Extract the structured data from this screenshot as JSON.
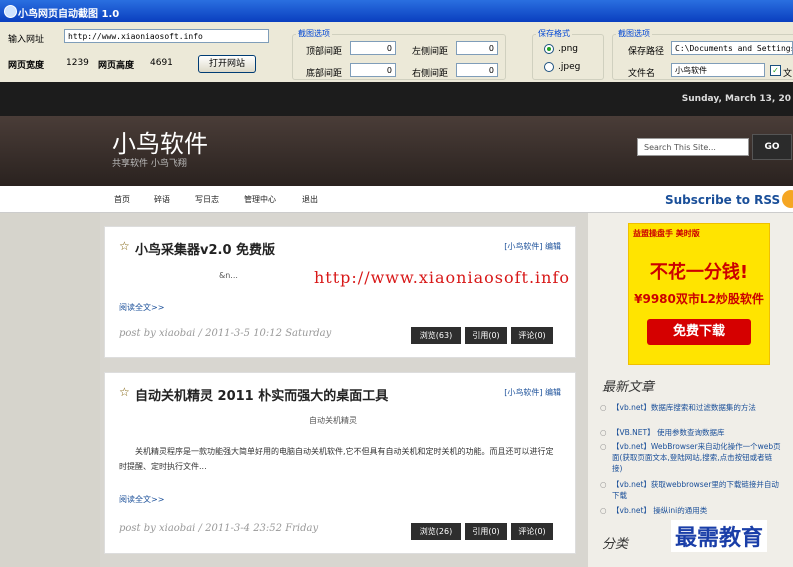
{
  "window": {
    "title": "小鸟网页自动截图 1.0"
  },
  "toolbar": {
    "url_label": "输入网址",
    "url_value": "http://www.xiaoniaosoft.info",
    "width_label": "网页宽度",
    "width_value": "1239",
    "height_label": "网页高度",
    "height_value": "4691",
    "open_button": "打开网站",
    "margins_group": "截图选项",
    "top_margin_label": "顶部间距",
    "top_margin_value": "0",
    "bottom_margin_label": "底部间距",
    "bottom_margin_value": "0",
    "left_margin_label": "左侧间距",
    "left_margin_value": "0",
    "right_margin_label": "右侧间距",
    "right_margin_value": "0",
    "format_group": "保存格式",
    "format_png": ".png",
    "format_jpeg": ".jpeg",
    "save_group": "截图选项",
    "save_path_label": "保存路径",
    "save_path_value": "C:\\Documents and Settings\\",
    "filename_label": "文件名",
    "filename_value": "小鸟软件",
    "checkbox_label": "文"
  },
  "site": {
    "date": "Sunday, March 13, 20",
    "title": "小鸟软件",
    "subtitle": "共享软件 小鸟飞翔",
    "search_placeholder": "Search This Site...",
    "search_button": "GO",
    "nav": [
      "首页",
      "碎语",
      "写日志",
      "管理中心",
      "退出"
    ],
    "rss": "Subscribe to RSS",
    "watermark": "http://www.xiaoniaosoft.info"
  },
  "posts": [
    {
      "title": "小鸟采集器v2.0 免费版",
      "category": "[小鸟软件] 编辑",
      "summary": "&n...",
      "read_more": "阅读全文>>",
      "meta": "post by xiaobai / 2011-3-5 10:12 Saturday",
      "browse": "浏览(63)",
      "quote": "引用(0)",
      "comment": "评论(0)"
    },
    {
      "title": "自动关机精灵  2011 朴实而强大的桌面工具",
      "category": "[小鸟软件] 编辑",
      "summary": "自动关机精灵",
      "body": "关机精灵程序是一款功能强大简单好用的电脑自动关机软件,它不但具有自动关机和定时关机的功能。而且还可以进行定时提醒、定时执行文件...",
      "read_more": "阅读全文>>",
      "meta": "post by xiaobai / 2011-3-4 23:52 Friday",
      "browse": "浏览(26)",
      "quote": "引用(0)",
      "comment": "评论(0)"
    }
  ],
  "sidebar": {
    "ad_logo": "益盟操盘手 美时版",
    "ad_line1": "不花一分钱!",
    "ad_line2": "¥9980双市L2炒股软件",
    "ad_button": "免费下载",
    "latest_heading": "最新文章",
    "latest": [
      "【vb.net】数据库搜索和过滤数据集的方法",
      "【VB.NET】 使用参数查询数据库",
      "【vb.net】WebBrowser来自动化操作一个web页面(获取页面文本,登陆网站,搜索,点击按钮或者链接)",
      "【vb.net】获取webbrowser里的下载链接并自动下载",
      "【vb.net】 操纵ini的通用类"
    ],
    "category_heading": "分类"
  },
  "corner_logo": "最需教育",
  "colors": {
    "title_bar": "#0a3fbf",
    "link": "#1a4f99",
    "watermark": "#d81818",
    "ad_bg": "#ffe400"
  }
}
